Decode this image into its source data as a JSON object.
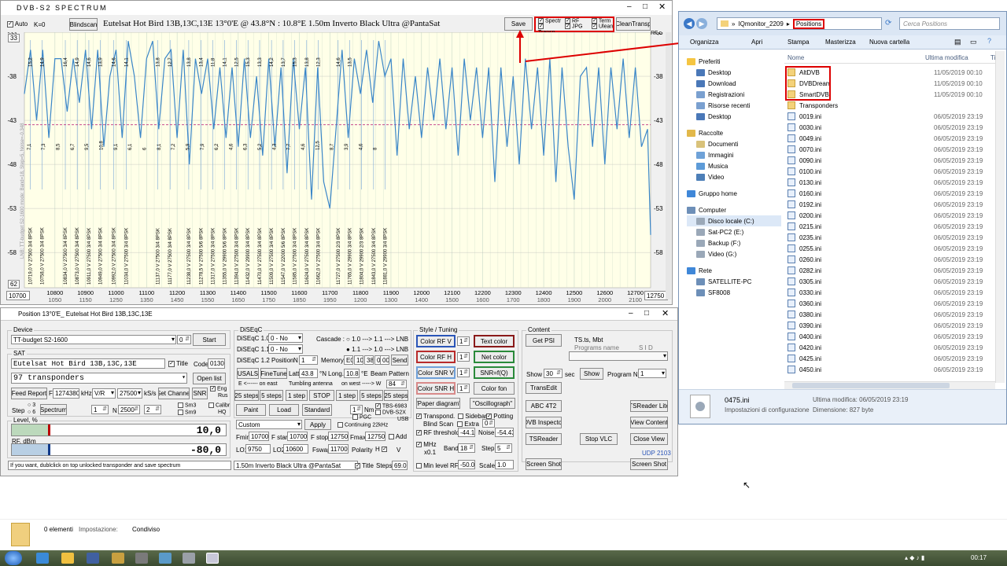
{
  "spectrum": {
    "title": "DVB-S2   SPECTRUM",
    "auto_label": "Auto",
    "k_label": "K=0",
    "blindscan_label": "Blindscan",
    "banner": "Eutelsat Hot Bird 13B,13C,13E     13°0'E  @  43.8°N : 10.8°E     1.50m  Inverto Black Ultra @PantaSat",
    "save_label": "Save",
    "checks": [
      "Spectr",
      "RF",
      "Term",
      "Transp.",
      "JPG",
      "Ulean"
    ],
    "clean_label": "CleanTransp",
    "rf_unit": "RF,c",
    "left_vertical_text": "LNB: TT-budget S2-1600 mode: Band=18, Step=5, Noise=-0.348",
    "y_ticks": [
      "-33",
      "-38",
      "-43",
      "-48",
      "-53",
      "-58"
    ],
    "y_top": "33",
    "y_bottom": "62",
    "start_freq": "10700",
    "end_freq": "12750",
    "x_ticks": [
      "10800",
      "10900",
      "11000",
      "11100",
      "11200",
      "11300",
      "11400",
      "11500",
      "11600",
      "11700",
      "11800",
      "11900",
      "12000",
      "12100",
      "12200",
      "12300",
      "12400",
      "12500",
      "12600",
      "12700"
    ],
    "x_ticks_if": [
      "1050",
      "1150",
      "1250",
      "1350",
      "1450",
      "1550",
      "1650",
      "1750",
      "1850",
      "1950",
      "1200",
      "1300",
      "1400",
      "1500",
      "1600",
      "1700",
      "1800",
      "1900",
      "2000",
      "2100"
    ],
    "peak_labels": [
      "15,2",
      "14,9",
      "16,4",
      "14,9",
      "14,6",
      "13,9",
      "14,6",
      "14,1",
      "13,8",
      "12,7",
      "13,8",
      "13,4",
      "11,8",
      "14,1",
      "12,5",
      "15,3",
      "13,3",
      "14,2",
      "13,7",
      "15,3",
      "13,8",
      "12,3",
      "14,6",
      "13,5"
    ],
    "low_labels": [
      "7,1",
      "7,3",
      "8,5",
      "6,7",
      "9,5",
      "10,8",
      "9,1",
      "6,1",
      "6",
      "8,1",
      "7,2",
      "5,9",
      "7,9",
      "6,2",
      "4,6",
      "6,3",
      "5,2",
      "4,3",
      "7,7",
      "4,6",
      "12,5",
      "8,7",
      "3,9",
      "4,6",
      "8"
    ],
    "transponders": [
      "10719,0 V 27500 3/4 8PSK",
      "10758,0 V 27500 3/4 8PSK",
      "10834,0 V 27500 3/4 8PSK",
      "10873,0 V 27500 3/4 8PSK",
      "10911,0 V 27500 3/4 8PSK",
      "10949,0 V 27500 3/4 8PSK",
      "10992,0 V 27500 3/4 8PSK",
      "11034,0 V 27500 3/4 8PSK",
      "11137,0 V 27500 3/4 8PSK",
      "11177,0 V 27500 3/4 8PSK",
      "11238,0 V 27500 3/4 8PSK",
      "11278,5 V 27500 5/6 8PSK",
      "11317,0 V 27500 3/4 8PSK",
      "11355,0 V 29900 5/6 8PSK",
      "11394,0 V 27500 3/4 8PSK",
      "11432,0 V 29900 3/4 8PSK",
      "11470,0 V 27500 3/4 8PSK",
      "11509,0 V 27500 3/4 8PSK",
      "11547,0 V 22000 5/6 8PSK",
      "11585,0 V 27500 3/4 8PSK",
      "11624,0 V 27500 3/4 8PSK",
      "11662,0 V 27500 3/4 8PSK",
      "11727,0 V 27500 2/3 8PSK",
      "11765,0 V 29900 3/4 8PSK",
      "11804,0 V 29900 2/3 8PSK",
      "11843,0 V 27500 3/4 8PSK",
      "11881,0 V 29900 3/4 8PSK"
    ],
    "chart_data": {
      "type": "line",
      "xlabel": "",
      "ylabel": "",
      "xlim": [
        10700,
        12750
      ],
      "ylim": [
        -62,
        -33
      ],
      "reference_level": -43.5,
      "series": [
        {
          "x": [
            10700,
            10720,
            10740,
            10760,
            10780,
            10800,
            10820,
            10840,
            10860,
            10880,
            10900,
            10920,
            10940,
            10960,
            10980,
            11000,
            11020,
            11040,
            11060,
            11080,
            11100,
            11120,
            11140,
            11160,
            11180,
            11200,
            11220,
            11240,
            11260,
            11280,
            11300,
            11320,
            11340,
            11360,
            11380,
            11400,
            11420,
            11440,
            11460,
            11480,
            11500,
            11520,
            11540,
            11560,
            11580,
            11600,
            11620,
            11640,
            11660,
            11680,
            11700,
            11720,
            11740,
            11760,
            11780,
            11800,
            11820,
            11840,
            11860,
            11880,
            11900,
            11920,
            11940,
            11960,
            11980,
            12000,
            12020,
            12040,
            12060,
            12080,
            12100,
            12120,
            12140,
            12160,
            12180,
            12200,
            12220,
            12240,
            12260,
            12280,
            12300,
            12320,
            12340,
            12360,
            12380,
            12400,
            12420,
            12440,
            12460,
            12480,
            12500,
            12520,
            12540,
            12560,
            12580,
            12600,
            12620,
            12640,
            12660,
            12680,
            12700,
            12720,
            12740,
            12750
          ],
          "y": [
            -40,
            -35,
            -43,
            -35,
            -45,
            -36,
            -36,
            -42,
            -36,
            -41,
            -35,
            -44,
            -35,
            -46,
            -38,
            -35,
            -45,
            -34,
            -38,
            -45,
            -36,
            -34,
            -44,
            -36,
            -35,
            -45,
            -35,
            -48,
            -36,
            -40,
            -36,
            -44,
            -37,
            -45,
            -37,
            -46,
            -36,
            -45,
            -38,
            -47,
            -36,
            -46,
            -37,
            -49,
            -36,
            -44,
            -37,
            -52,
            -37,
            -50,
            -53,
            -44,
            -35,
            -45,
            -36,
            -40,
            -35,
            -41,
            -34,
            -38,
            -36,
            -47,
            -36,
            -44,
            -38,
            -45,
            -37,
            -43,
            -36,
            -44,
            -37,
            -47,
            -36,
            -43,
            -37,
            -45,
            -37,
            -50,
            -37,
            -46,
            -38,
            -48,
            -36,
            -44,
            -37,
            -47,
            -36,
            -50,
            -37,
            -46,
            -52,
            -38,
            -37,
            -46,
            -37,
            -48,
            -37,
            -44,
            -36,
            -45,
            -37,
            -46,
            -44,
            -56
          ]
        }
      ]
    }
  },
  "position": {
    "title": "Position 13°0'E_  Eutelsat Hot Bird 13B,13C,13E",
    "device_group": "Device",
    "device_value": "TT-budget S2-1600",
    "device_num": "0",
    "start_label": "Start",
    "sat_group": "SAT",
    "sat_name": "Eutelsat Hot Bird 13B,13C,13E",
    "title_check": "Title",
    "code_label": "Code",
    "code_value": "0130",
    "transponders_value": "97  transponders",
    "open_list": "Open list",
    "feed_report": "Feed Report",
    "f_label": "F",
    "f_value": "12743800",
    "khz_label": "kHz",
    "vr_value": "V/R",
    "sr_value": "27500",
    "ksps_label": "kS/s",
    "set_channel": "Set Channel",
    "snr_label": "SNR",
    "eng_label": "Eng",
    "rus_label": "Rus",
    "step_label": "Step",
    "step_3": "3",
    "step_6": "6",
    "spectrum_btn": "Spectrum",
    "step_val": "1",
    "n_label": "N",
    "n_val": "2500",
    "x_val": "2",
    "sm3": "Sm3",
    "sm9": "Sm9",
    "calibr": "Calibr",
    "hq": "HQ",
    "level_label": "Level, %",
    "level_value": "10,0",
    "rf_label": "RF, dBm",
    "rf_value": "-80,0",
    "status_text": "If you want, dublclick on top unlocked transponder and save spectrum",
    "diseqc_group": "DiSEqC",
    "diseqc10": "DiSEqC 1.0",
    "diseqc11": "DiSEqC 1.1",
    "diseqc12": "DiSEqC 1.2",
    "no_value": "0 - No",
    "cascade": "Cascade :",
    "cascade_a": "1.0 ---> 1.1 ---> LNB",
    "cascade_b": "1.1 ---> 1.0 ---> LNB",
    "position_label": "Position",
    "n_pos": "N",
    "n_pos_val": "1",
    "memory_label": "Memory",
    "mem_e0": "E0",
    "mem_10": "10",
    "mem_38": "38",
    "mem_00a": "00",
    "mem_00b": "00",
    "send_label": "Send",
    "usals": "USALS",
    "finetune": "FineTune",
    "latt": "Latt",
    "latt_val": "43.8",
    "n_deg": "°N",
    "long": "Long.",
    "long_val": "10.8",
    "e_deg": "°E",
    "beam": "Beam Pattern",
    "east": "E <------  on  east",
    "tumbling": "Tumbling antenna",
    "west": "on  west  -----> W",
    "west_val": "84",
    "steps25a": "25 steps",
    "steps5a": "5 steps",
    "step1a": "1 step",
    "stop": "STOP",
    "step1b": "1 step",
    "steps5b": "5 steps",
    "steps25b": "25 steps",
    "paint": "Paint",
    "load": "Load",
    "standard": "Standard",
    "nm_val": "1",
    "nm_label": "Nm",
    "pgc": "PGC",
    "tbs": "TBS-6983",
    "dvbs2x": "DVB-S2X",
    "usb": "USB",
    "continuing": "Continuing 22kHz",
    "custom": "Custom",
    "apply": "Apply",
    "fmin": "Fmin",
    "fmin_val": "10700",
    "fstart": "F start",
    "fstart_val": "10700",
    "fstop": "F stop",
    "fstop_val": "12750",
    "fmax": "Fmax",
    "fmax_val": "12750",
    "add": "Add",
    "lo1": "LO1",
    "lo1_val": "9750",
    "lo2": "LO2",
    "lo2_val": "10600",
    "fswap": "Fswap",
    "fswap_val": "11700",
    "polarity": "Polarity",
    "pol_h": "H",
    "pol_v": "V",
    "lnb_desc": "1.50m  Inverto Black Ultra @PantaSat",
    "title_cb": "Title",
    "steps_label": "Steps",
    "steps_val": "69.0",
    "style_group": "Style / Tuning",
    "color_rfv": "Color  RF V",
    "color_rfh": "Color  RF H",
    "color_snrv": "Color  SNR V",
    "color_snrh": "Color  SNR H",
    "spin1": "1",
    "text_color": "Text color",
    "net_color": "Net color",
    "snr_fq": "SNR=f(Q)",
    "color_fon": "Color fon",
    "paper": "\"Paper diagram\"",
    "oscillo": "\"Oscillograph\"",
    "transpond": "Transpond.",
    "sidebar_cb": "Sidebar",
    "potting": "Potting",
    "blind": "Blind",
    "scan": "Scan",
    "extra": "Extra",
    "extra_val": "0",
    "rf_threshold": "RF threshold",
    "rf_threshold_val": "-44.1",
    "noise": "Noise",
    "noise_val": "-54.43",
    "mhz": "MHz",
    "x01": "x0.1",
    "band": "Band",
    "band_val": "18",
    "step2": "Step",
    "step2_val": "5",
    "minlevel": "Min level RF",
    "minlevel_val": "-50.0",
    "scale": "Scale",
    "scale_val": "1.0",
    "content_group": "Content",
    "get_psi": "Get  PSI",
    "ts_mbt": "TS.ts,  Mbt",
    "programs_name": "Programs   name",
    "sid": "S I D",
    "show": "Show",
    "show_val": "30",
    "sec": "sec",
    "show_btn": "Show",
    "program_n": "Program  N",
    "program_val": "1",
    "transedit": "TransEdit",
    "abc": "ABC  4T2",
    "tsreader_lite": "TSReader Lite",
    "dvb_inspector": "DVB Inspector",
    "view_content": "View Content",
    "tsreader": "TSReader",
    "stop_vlc": "Stop  VLC",
    "close_view": "Close View",
    "udp": "UDP 2103",
    "screenshot1": "Screen Shot",
    "screenshot2": "Screen Shot"
  },
  "explorer": {
    "breadcrumb_1": "IQmonitor_2209",
    "breadcrumb_2": "Positions",
    "search_placeholder": "Cerca Positions",
    "organizza": "Organizza",
    "apri": "Apri",
    "stampa": "Stampa",
    "masterizza": "Masterizza",
    "nuova_cartella": "Nuova cartella",
    "col_nome": "Nome",
    "col_mod": "Ultima modifica",
    "col_t": "Ti",
    "nav": [
      {
        "label": "Preferiti",
        "color": "#f5c542",
        "head": true
      },
      {
        "label": "Desktop",
        "color": "#4a78b8"
      },
      {
        "label": "Download",
        "color": "#4a78b8"
      },
      {
        "label": "Registrazioni",
        "color": "#7aa0d0"
      },
      {
        "label": "Risorse recenti",
        "color": "#7aa0d0"
      },
      {
        "label": "Desktop",
        "color": "#4a78b8"
      },
      {
        "label": "",
        "gap": true
      },
      {
        "label": "Raccolte",
        "color": "#e2b84a",
        "head": true
      },
      {
        "label": "Documenti",
        "color": "#d9c27a"
      },
      {
        "label": "Immagini",
        "color": "#6fa2d8"
      },
      {
        "label": "Musica",
        "color": "#5d9bd8"
      },
      {
        "label": "Video",
        "color": "#4d7fb8"
      },
      {
        "label": "",
        "gap": true
      },
      {
        "label": "Gruppo home",
        "color": "#3f87d8",
        "head": true
      },
      {
        "label": "",
        "gap": true
      },
      {
        "label": "Computer",
        "color": "#6d8fb8",
        "head": true
      },
      {
        "label": "Disco locale (C:)",
        "color": "#9aa8b8",
        "sel": true
      },
      {
        "label": "Sat-PC2 (E:)",
        "color": "#9aa8b8"
      },
      {
        "label": "Backup (F:)",
        "color": "#9aa8b8"
      },
      {
        "label": "Video (G:)",
        "color": "#9aa8b8"
      },
      {
        "label": "",
        "gap": true
      },
      {
        "label": "Rete",
        "color": "#3f87d8",
        "head": true
      },
      {
        "label": "SATELLITE-PC",
        "color": "#6d8fb8"
      },
      {
        "label": "SF8008",
        "color": "#6d8fb8"
      }
    ],
    "files": [
      {
        "name": "AltDVB",
        "date": "11/05/2019 00:10",
        "folder": true
      },
      {
        "name": "DVBDream",
        "date": "11/05/2019 00:10",
        "folder": true
      },
      {
        "name": "SmartDVB",
        "date": "11/05/2019 00:10",
        "folder": true
      },
      {
        "name": "Transponders",
        "date": "",
        "folder": true
      },
      {
        "name": "0019.ini",
        "date": "06/05/2019 23:19"
      },
      {
        "name": "0030.ini",
        "date": "06/05/2019 23:19"
      },
      {
        "name": "0049.ini",
        "date": "06/05/2019 23:19"
      },
      {
        "name": "0070.ini",
        "date": "06/05/2019 23:19"
      },
      {
        "name": "0090.ini",
        "date": "06/05/2019 23:19"
      },
      {
        "name": "0100.ini",
        "date": "06/05/2019 23:19"
      },
      {
        "name": "0130.ini",
        "date": "06/05/2019 23:19"
      },
      {
        "name": "0160.ini",
        "date": "06/05/2019 23:19"
      },
      {
        "name": "0192.ini",
        "date": "06/05/2019 23:19"
      },
      {
        "name": "0200.ini",
        "date": "06/05/2019 23:19"
      },
      {
        "name": "0215.ini",
        "date": "06/05/2019 23:19"
      },
      {
        "name": "0235.ini",
        "date": "06/05/2019 23:19"
      },
      {
        "name": "0255.ini",
        "date": "06/05/2019 23:19"
      },
      {
        "name": "0260.ini",
        "date": "06/05/2019 23:19"
      },
      {
        "name": "0282.ini",
        "date": "06/05/2019 23:19"
      },
      {
        "name": "0305.ini",
        "date": "06/05/2019 23:19"
      },
      {
        "name": "0330.ini",
        "date": "06/05/2019 23:19"
      },
      {
        "name": "0360.ini",
        "date": "06/05/2019 23:19"
      },
      {
        "name": "0380.ini",
        "date": "06/05/2019 23:19"
      },
      {
        "name": "0390.ini",
        "date": "06/05/2019 23:19"
      },
      {
        "name": "0400.ini",
        "date": "06/05/2019 23:19"
      },
      {
        "name": "0420.ini",
        "date": "06/05/2019 23:19"
      },
      {
        "name": "0425.ini",
        "date": "06/05/2019 23:19"
      },
      {
        "name": "0450.ini",
        "date": "06/05/2019 23:19"
      }
    ],
    "detail_name": "0475.ini",
    "detail_type": "Impostazioni di configurazione",
    "detail_mod": "Ultima modifica: 06/05/2019 23:19",
    "detail_size": "Dimensione: 827 byte"
  },
  "desktop": {
    "elements": "0 elementi",
    "impostazione": "Impostazione:",
    "condiviso": "Condiviso"
  },
  "taskbar": {
    "clock": "00:17"
  }
}
